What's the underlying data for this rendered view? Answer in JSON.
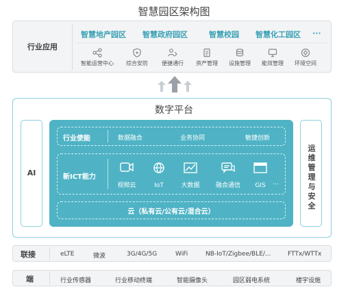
{
  "title": "智慧园区架构图",
  "industry": {
    "label": "行业应用",
    "apps": [
      "智慧地产园区",
      "智慧政府园区",
      "智慧校园",
      "智慧化工园区",
      "···"
    ],
    "services": [
      {
        "label": "智能运营中心",
        "icon": "share-icon"
      },
      {
        "label": "综合安防",
        "icon": "shield-icon"
      },
      {
        "label": "便捷通行",
        "icon": "people-icon"
      },
      {
        "label": "资产管理",
        "icon": "document-icon"
      },
      {
        "label": "设施管理",
        "icon": "facility-icon"
      },
      {
        "label": "能效管理",
        "icon": "monitor-icon"
      },
      {
        "label": "环境空间",
        "icon": "globe-icon"
      }
    ]
  },
  "platform": {
    "title": "数字平台",
    "left_side": "AI",
    "right_side": "运维管理与安全",
    "enable_row": {
      "label": "行业使能",
      "items": [
        "数据融合",
        "业务协同",
        "敏捷创新"
      ]
    },
    "ict_row": {
      "label": "新ICT能力",
      "items": [
        {
          "label": "视频云",
          "icon": "video-icon"
        },
        {
          "label": "IoT",
          "icon": "iot-icon"
        },
        {
          "label": "大数据",
          "icon": "chart-icon"
        },
        {
          "label": "融合通信",
          "icon": "chat-icon"
        },
        {
          "label": "GIS",
          "icon": "map-icon"
        }
      ],
      "more": "..."
    },
    "cloud_row": "云（私有云/公有云/混合云）"
  },
  "connect": {
    "label": "联接",
    "items": [
      "eLTE",
      "微波",
      "3G/4G/5G",
      "WiFi",
      "NB-IoT/Zigbee/BLE/...",
      "FTTx/WTTx"
    ]
  },
  "edge": {
    "label": "端",
    "items": [
      "行业传感器",
      "行业移动终端",
      "智能摄像头",
      "园区弱电系统",
      "楼宇设施"
    ]
  },
  "colors": {
    "accent": "#4fb3c5",
    "accent_light": "#8ccfdc",
    "panel": "#f3f4f5"
  }
}
